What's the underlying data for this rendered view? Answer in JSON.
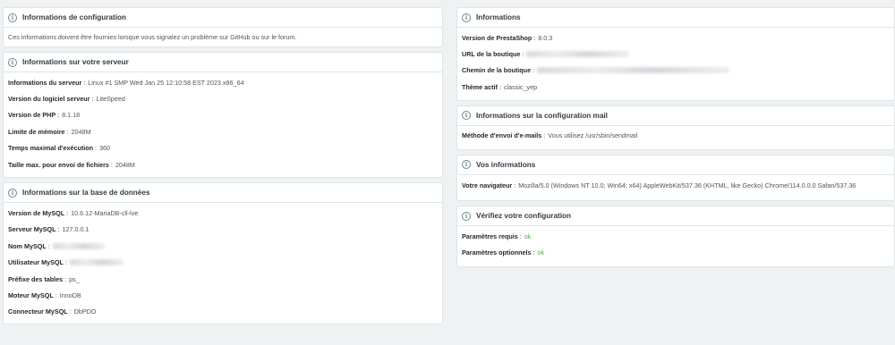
{
  "left": {
    "config": {
      "title": "Informations de configuration",
      "description": "Ces informations doivent être fournies lorsque vous signalez un problème sur GitHub ou sur le forum."
    },
    "server": {
      "title": "Informations sur votre serveur",
      "rows": [
        {
          "label": "Informations du serveur",
          "value": "Linux #1 SMP Wed Jan 25 12:10:58 EST 2023 x86_64"
        },
        {
          "label": "Version du logiciel serveur",
          "value": "LiteSpeed"
        },
        {
          "label": "Version de PHP",
          "value": "8.1.18"
        },
        {
          "label": "Limite de mémoire",
          "value": "2048M"
        },
        {
          "label": "Temps maximal d'exécution",
          "value": "360"
        },
        {
          "label": "Taille max. pour envoi de fichiers",
          "value": "2048M"
        }
      ]
    },
    "database": {
      "title": "Informations sur la base de données",
      "rows": [
        {
          "label": "Version de MySQL",
          "value": "10.6.12-MariaDB-cll-lve"
        },
        {
          "label": "Serveur MySQL",
          "value": "127.0.0.1"
        },
        {
          "label": "Nom MySQL",
          "value": ""
        },
        {
          "label": "Utilisateur MySQL",
          "value": ""
        },
        {
          "label": "Préfixe des tables",
          "value": "ps_"
        },
        {
          "label": "Moteur MySQL",
          "value": "InnoDB"
        },
        {
          "label": "Connecteur MySQL",
          "value": "DbPDO"
        }
      ]
    }
  },
  "right": {
    "info": {
      "title": "Informations",
      "rows": [
        {
          "label": "Version de PrestaShop",
          "value": "8.0.3"
        },
        {
          "label": "URL de la boutique",
          "value": ""
        },
        {
          "label": "Chemin de la boutique",
          "value": ""
        },
        {
          "label": "Thème actif",
          "value": "classic_yep"
        }
      ]
    },
    "mail": {
      "title": "Informations sur la configuration mail",
      "rows": [
        {
          "label": "Méthode d'envoi d'e-mails",
          "value": "Vous utilisez /usr/sbin/sendmail"
        }
      ]
    },
    "yours": {
      "title": "Vos informations",
      "rows": [
        {
          "label": "Votre navigateur",
          "value": "Mozilla/5.0 (Windows NT 10.0; Win64; x64) AppleWebKit/537.36 (KHTML, like Gecko) Chrome/114.0.0.0 Safari/537.36"
        }
      ]
    },
    "check": {
      "title": "Vérifiez votre configuration",
      "rows": [
        {
          "label": "Paramètres requis",
          "value": "ok"
        },
        {
          "label": "Paramètres optionnels",
          "value": "ok"
        }
      ]
    }
  },
  "icons": {
    "header_icon": "info-circle-icon",
    "glyph": "i"
  },
  "colors": {
    "ok": "#52a94e",
    "background": "#eff1f2",
    "card_border": "#dbe6e9"
  }
}
